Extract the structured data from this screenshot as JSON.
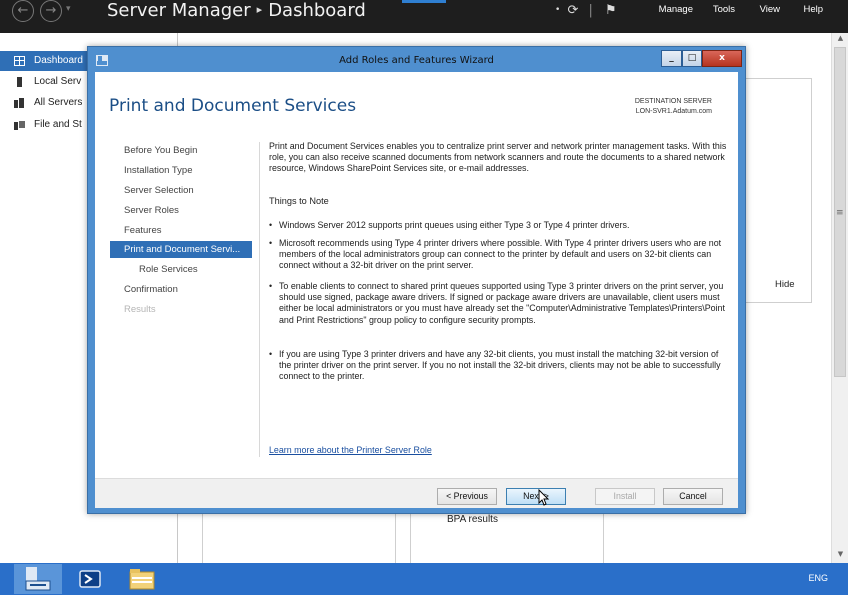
{
  "server_manager": {
    "title": "Server Manager",
    "breadcrumb_sep": "▸",
    "page": "Dashboard",
    "menu": [
      "Manage",
      "Tools",
      "View",
      "Help"
    ],
    "sidebar": [
      {
        "label": "Dashboard",
        "active": true
      },
      {
        "label": "Local Serv",
        "active": false
      },
      {
        "label": "All Servers",
        "active": false
      },
      {
        "label": "File and St",
        "active": false
      }
    ],
    "hide_label": "Hide",
    "bpa_label": "BPA results"
  },
  "wizard": {
    "title": "Add Roles and Features Wizard",
    "window_controls": {
      "minimize": "_",
      "maximize": "□",
      "close": "x"
    },
    "heading": "Print and Document Services",
    "destination": {
      "label": "DESTINATION SERVER",
      "server": "LON-SVR1.Adatum.com"
    },
    "nav": [
      {
        "label": "Before You Begin",
        "state": "normal"
      },
      {
        "label": "Installation Type",
        "state": "normal"
      },
      {
        "label": "Server Selection",
        "state": "normal"
      },
      {
        "label": "Server Roles",
        "state": "normal"
      },
      {
        "label": "Features",
        "state": "normal"
      },
      {
        "label": "Print and Document Servi...",
        "state": "selected"
      },
      {
        "label": "Role Services",
        "state": "sub"
      },
      {
        "label": "Confirmation",
        "state": "normal"
      },
      {
        "label": "Results",
        "state": "disabled"
      }
    ],
    "intro": "Print and Document Services enables you to centralize print server and network printer management tasks. With this role, you can also receive scanned documents from network scanners and route the documents to a shared network resource, Windows SharePoint Services site, or e-mail addresses.",
    "notes_title": "Things to Note",
    "notes": [
      "Windows Server 2012 supports print queues using either Type 3 or Type 4 printer drivers.",
      "Microsoft recommends using Type 4 printer drivers where possible. With Type 4 printer drivers users who are not members of the local administrators group can connect to the printer by default and users on 32-bit clients can connect without a 32-bit driver on the print server.",
      "To enable clients to connect to shared print queues supported using Type 3 printer drivers on the print server, you should use signed, package aware drivers. If signed or package aware drivers are unavailable, client users must either be local administrators or you must have already set the \"Computer\\Administrative Templates\\Printers\\Point and Print Restrictions\" group policy to configure security prompts.",
      "If you are using Type 3 printer drivers and have any 32-bit clients, you must install the matching 32-bit version of the printer driver on the print server. If you no not install the 32-bit drivers, clients may not be able to successfully connect to the printer."
    ],
    "learn_link": "Learn more about the Printer Server Role",
    "buttons": {
      "previous": "< Previous",
      "next": "Next >",
      "install": "Install",
      "cancel": "Cancel"
    }
  },
  "taskbar": {
    "lang": "ENG"
  },
  "colors": {
    "accent": "#2f6fb6",
    "title_bar": "#4f8fcf",
    "taskbar": "#2a6fc9",
    "heading": "#1b4e86"
  }
}
